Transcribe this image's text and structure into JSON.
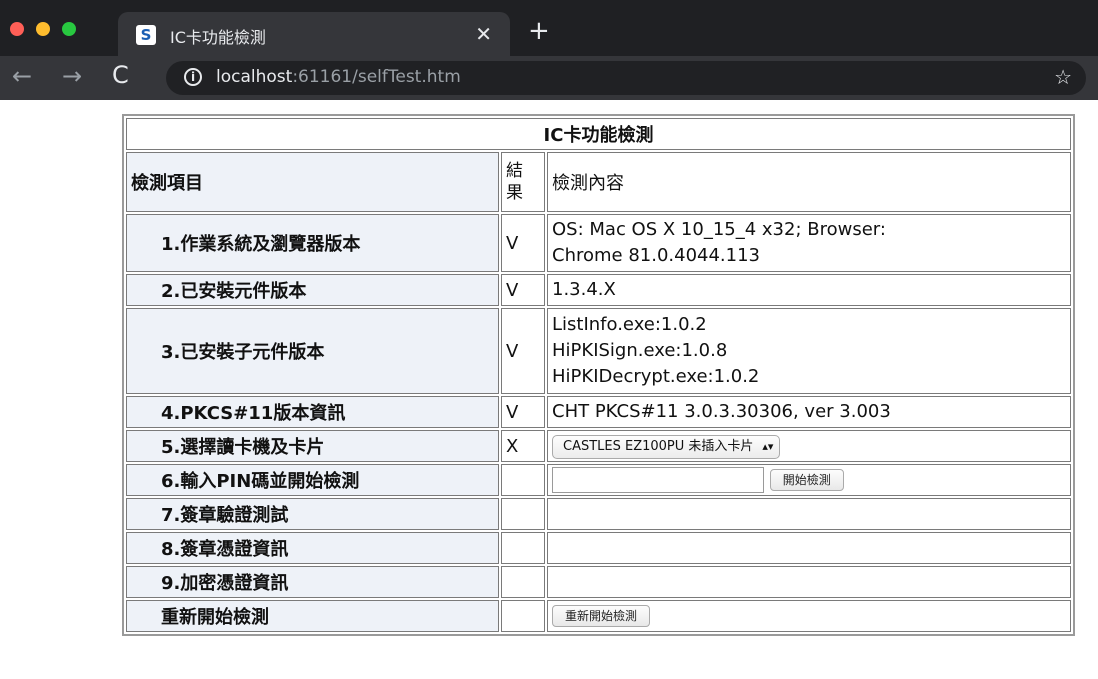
{
  "browser": {
    "tab_title": "IC卡功能檢測",
    "tab_favicon": "S",
    "url_host": "localhost",
    "url_rest": ":61161/selfTest.htm",
    "icons": [
      "back-icon",
      "forward-icon",
      "reload-icon",
      "info-icon",
      "star-icon",
      "close-icon",
      "plus-icon"
    ]
  },
  "table": {
    "title": "IC卡功能檢測",
    "headers": {
      "item": "檢測項目",
      "result": "結果",
      "detail": "檢測內容"
    },
    "rows": [
      {
        "item": "1.作業系統及瀏覽器版本",
        "result": "V",
        "detail": [
          "OS: Mac OS X 10_15_4 x32;  Browser:",
          "Chrome 81.0.4044.113"
        ]
      },
      {
        "item": "2.已安裝元件版本",
        "result": "V",
        "detail": [
          "1.3.4.X"
        ]
      },
      {
        "item": "3.已安裝子元件版本",
        "result": "V",
        "detail": [
          "ListInfo.exe:1.0.2",
          "HiPKISign.exe:1.0.8",
          "HiPKIDecrypt.exe:1.0.2"
        ]
      },
      {
        "item": "4.PKCS#11版本資訊",
        "result": "V",
        "detail": [
          "CHT PKCS#11 3.0.3.30306, ver 3.003"
        ]
      },
      {
        "item": "5.選擇讀卡機及卡片",
        "result": "X",
        "select_value": "CASTLES EZ100PU 未插入卡片"
      },
      {
        "item": "6.輸入PIN碼並開始檢測",
        "result": "",
        "button": "開始檢測"
      },
      {
        "item": "7.簽章驗證測試",
        "result": ""
      },
      {
        "item": "8.簽章憑證資訊",
        "result": ""
      },
      {
        "item": "9.加密憑證資訊",
        "result": ""
      },
      {
        "item": "重新開始檢測",
        "result": "",
        "button": "重新開始檢測"
      }
    ]
  }
}
